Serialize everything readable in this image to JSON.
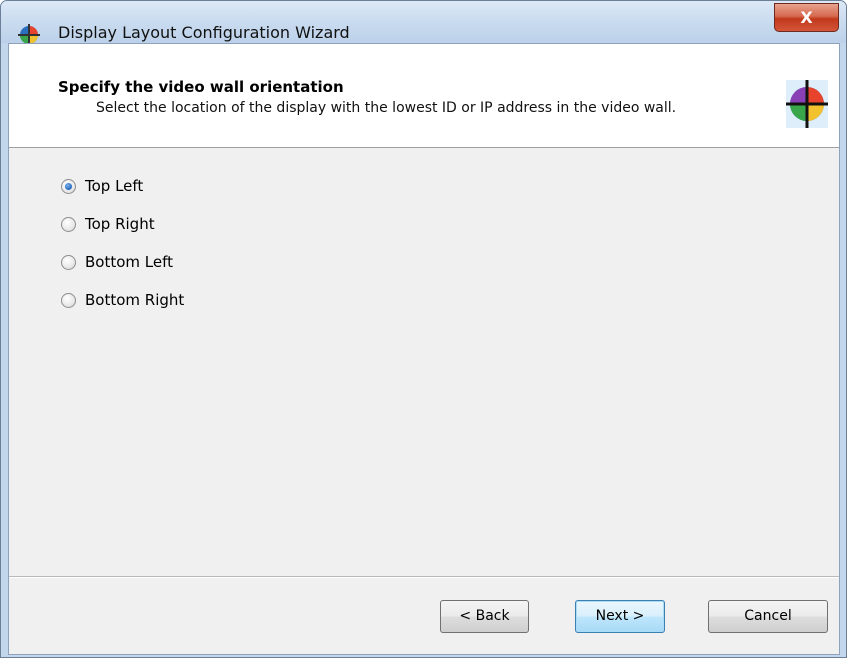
{
  "window": {
    "title": "Display Layout Configuration Wizard",
    "close_label": "X"
  },
  "header": {
    "title": "Specify the video wall orientation",
    "subtitle": "Select the location of the display with the lowest ID or IP address in the video wall.",
    "icon": "display-layout-icon"
  },
  "options": [
    {
      "label": "Top Left",
      "checked": true
    },
    {
      "label": "Top Right",
      "checked": false
    },
    {
      "label": "Bottom Left",
      "checked": false
    },
    {
      "label": "Bottom Right",
      "checked": false
    }
  ],
  "buttons": {
    "back": "< Back",
    "next": "Next >",
    "cancel": "Cancel"
  },
  "colors": {
    "accent": "#2c6fc4",
    "close_button": "#c2391c"
  }
}
